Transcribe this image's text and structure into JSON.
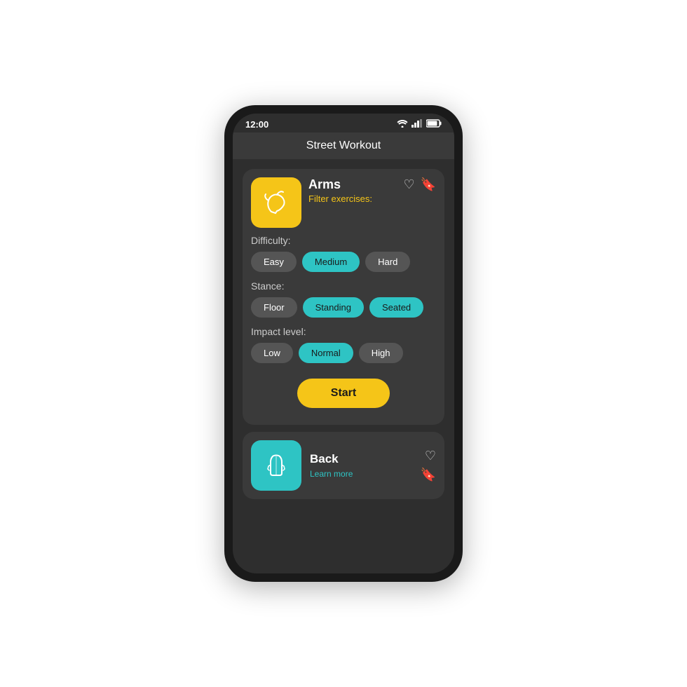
{
  "status": {
    "time": "12:00",
    "wifi": "wifi",
    "signal": "signal",
    "battery": "battery"
  },
  "header": {
    "title": "Street Workout"
  },
  "card1": {
    "title": "Arms",
    "subtitle": "Filter exercises:",
    "difficulty_label": "Difficulty:",
    "difficulty_options": [
      {
        "label": "Easy",
        "active": false
      },
      {
        "label": "Medium",
        "active": true
      },
      {
        "label": "Hard",
        "active": false
      }
    ],
    "stance_label": "Stance:",
    "stance_options": [
      {
        "label": "Floor",
        "active": false
      },
      {
        "label": "Standing",
        "active": true
      },
      {
        "label": "Seated",
        "active": true
      }
    ],
    "impact_label": "Impact level:",
    "impact_options": [
      {
        "label": "Low",
        "active": false
      },
      {
        "label": "Normal",
        "active": true
      },
      {
        "label": "High",
        "active": false
      }
    ],
    "start_label": "Start"
  },
  "card2": {
    "title": "Back",
    "learn_more": "Learn more"
  }
}
